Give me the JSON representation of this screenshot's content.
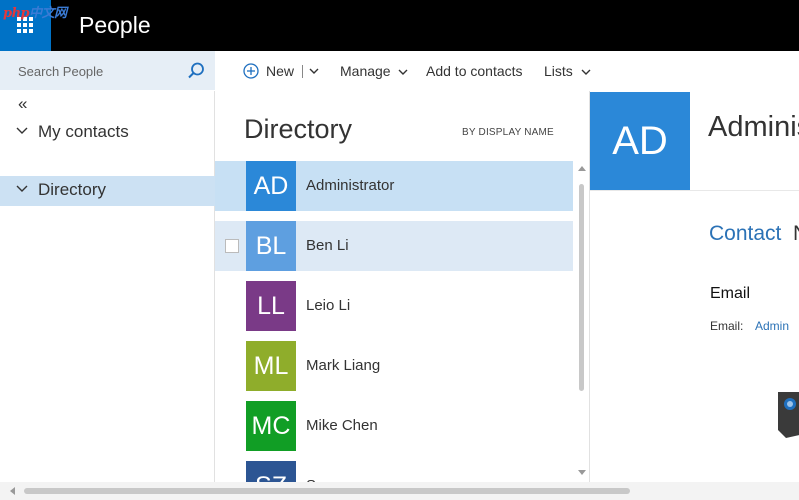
{
  "watermark": {
    "text_a": "php",
    "text_b": "中文网"
  },
  "app": {
    "title": "People"
  },
  "search": {
    "placeholder": "Search People"
  },
  "toolbar": {
    "new_label": "New",
    "manage_label": "Manage",
    "add_contacts_label": "Add to contacts",
    "lists_label": "Lists"
  },
  "nav": {
    "collapse_glyph": "«",
    "items": [
      {
        "label": "My contacts"
      },
      {
        "label": "Directory"
      }
    ]
  },
  "list": {
    "title": "Directory",
    "sort": "BY DISPLAY NAME",
    "rows": [
      {
        "initials": "AD",
        "name": "Administrator",
        "color": "#2b88d8"
      },
      {
        "initials": "BL",
        "name": "Ben Li",
        "color": "#5e9fe0"
      },
      {
        "initials": "LL",
        "name": "Leio Li",
        "color": "#7a3a87"
      },
      {
        "initials": "ML",
        "name": "Mark Liang",
        "color": "#8fad2b"
      },
      {
        "initials": "MC",
        "name": "Mike Chen",
        "color": "#119e25"
      },
      {
        "initials": "SZ",
        "name": "S",
        "color": "#2c5593"
      }
    ]
  },
  "detail": {
    "initials": "AD",
    "name": "Adminis",
    "tab_contact": "Contact",
    "tab_next": "N",
    "section_email": "Email",
    "email_label": "Email:",
    "email_value": "Admin"
  },
  "colors": {
    "brand": "#0072c6",
    "topbar": "#000000",
    "accent": "#2b88d8",
    "link": "#2b72b6"
  }
}
